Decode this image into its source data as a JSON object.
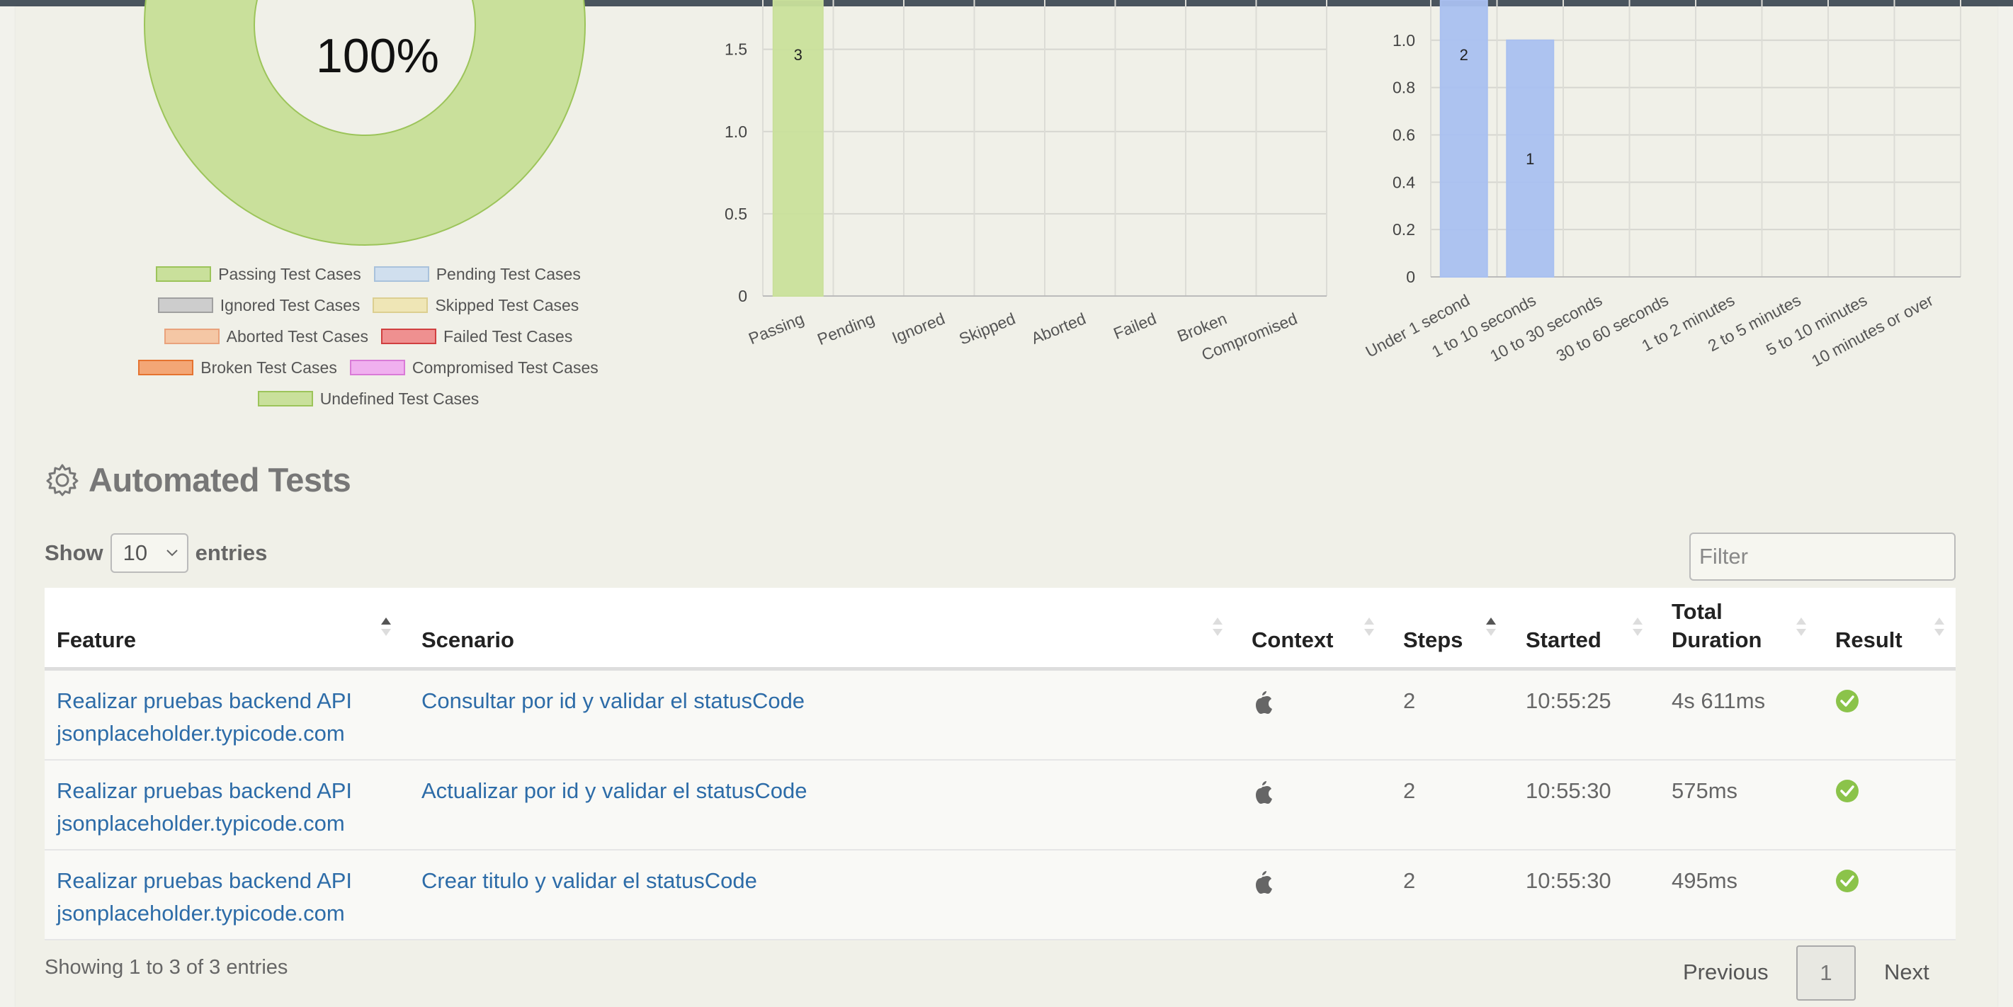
{
  "colors": {
    "passing": "#c9e09b",
    "duration_bar": "#a9c0f0",
    "link": "#2d6ca8",
    "ok": "#8bc34a"
  },
  "donut": {
    "label": "100%",
    "passing_fraction": 1.0
  },
  "legend": [
    [
      {
        "label": "Passing Test Cases",
        "fill": "#c9e09b",
        "border": "#9cc45a"
      },
      {
        "label": "Pending Test Cases",
        "fill": "#d0dfee",
        "border": "#a9c2dc"
      }
    ],
    [
      {
        "label": "Ignored Test Cases",
        "fill": "#cdcdcd",
        "border": "#a0a0a0"
      },
      {
        "label": "Skipped Test Cases",
        "fill": "#efe6b6",
        "border": "#dccf91"
      }
    ],
    [
      {
        "label": "Aborted Test Cases",
        "fill": "#f5c7a5",
        "border": "#e9a27c"
      },
      {
        "label": "Failed Test Cases",
        "fill": "#ef9090",
        "border": "#d04040"
      }
    ],
    [
      {
        "label": "Broken Test Cases",
        "fill": "#f3a676",
        "border": "#e57330"
      },
      {
        "label": "Compromised Test Cases",
        "fill": "#f0b0ef",
        "border": "#d97bd7"
      }
    ],
    [
      {
        "label": "Undefined Test Cases",
        "fill": "#c9e09b",
        "border": "#9cc45a"
      }
    ]
  ],
  "chart_data": [
    {
      "type": "bar",
      "categories": [
        "Passing",
        "Pending",
        "Ignored",
        "Skipped",
        "Aborted",
        "Failed",
        "Broken",
        "Compromised"
      ],
      "values": [
        3,
        0,
        0,
        0,
        0,
        0,
        0,
        0
      ],
      "data_labels": [
        "3",
        "",
        "",
        "",
        "",
        "",
        "",
        ""
      ],
      "yticks": [
        "0",
        "0.5",
        "1.0",
        "1.5"
      ],
      "ylim": [
        0,
        1.8
      ],
      "grid": true,
      "color": "#c9e09b"
    },
    {
      "type": "bar",
      "categories": [
        "Under 1 second",
        "1 to 10 seconds",
        "10 to 30 seconds",
        "30 to 60 seconds",
        "1 to 2 minutes",
        "2 to 5 minutes",
        "5 to 10 minutes",
        "10 minutes or over"
      ],
      "values": [
        2,
        1,
        0,
        0,
        0,
        0,
        0,
        0
      ],
      "data_labels": [
        "2",
        "1",
        "",
        "",
        "",
        "",
        "",
        ""
      ],
      "yticks": [
        "0",
        "0.2",
        "0.4",
        "0.6",
        "0.8",
        "1.0"
      ],
      "ylim": [
        0,
        1.17
      ],
      "grid": true,
      "color": "#a9c0f0"
    }
  ],
  "section": {
    "title": "Automated Tests"
  },
  "controls": {
    "show_label": "Show",
    "entries_value": "10",
    "entries_label": "entries",
    "filter_placeholder": "Filter"
  },
  "table": {
    "headers": {
      "feature": "Feature",
      "scenario": "Scenario",
      "context": "Context",
      "steps": "Steps",
      "started": "Started",
      "total": "Total",
      "duration": "Duration",
      "result": "Result"
    },
    "rows": [
      {
        "feature_1": "Realizar pruebas backend API",
        "feature_2": "jsonplaceholder.typicode.com",
        "scenario": "Consultar por id y validar el statusCode",
        "context_icon": "apple-icon",
        "steps": "2",
        "started": "10:55:25",
        "duration": "4s 611ms",
        "result_icon": "success-check-icon"
      },
      {
        "feature_1": "Realizar pruebas backend API",
        "feature_2": "jsonplaceholder.typicode.com",
        "scenario": "Actualizar por id y validar el statusCode",
        "context_icon": "apple-icon",
        "steps": "2",
        "started": "10:55:30",
        "duration": "575ms",
        "result_icon": "success-check-icon"
      },
      {
        "feature_1": "Realizar pruebas backend API",
        "feature_2": "jsonplaceholder.typicode.com",
        "scenario": "Crear titulo y validar el statusCode",
        "context_icon": "apple-icon",
        "steps": "2",
        "started": "10:55:30",
        "duration": "495ms",
        "result_icon": "success-check-icon"
      }
    ]
  },
  "footer": {
    "info": "Showing 1 to 3 of 3 entries",
    "previous": "Previous",
    "page": "1",
    "next": "Next"
  }
}
